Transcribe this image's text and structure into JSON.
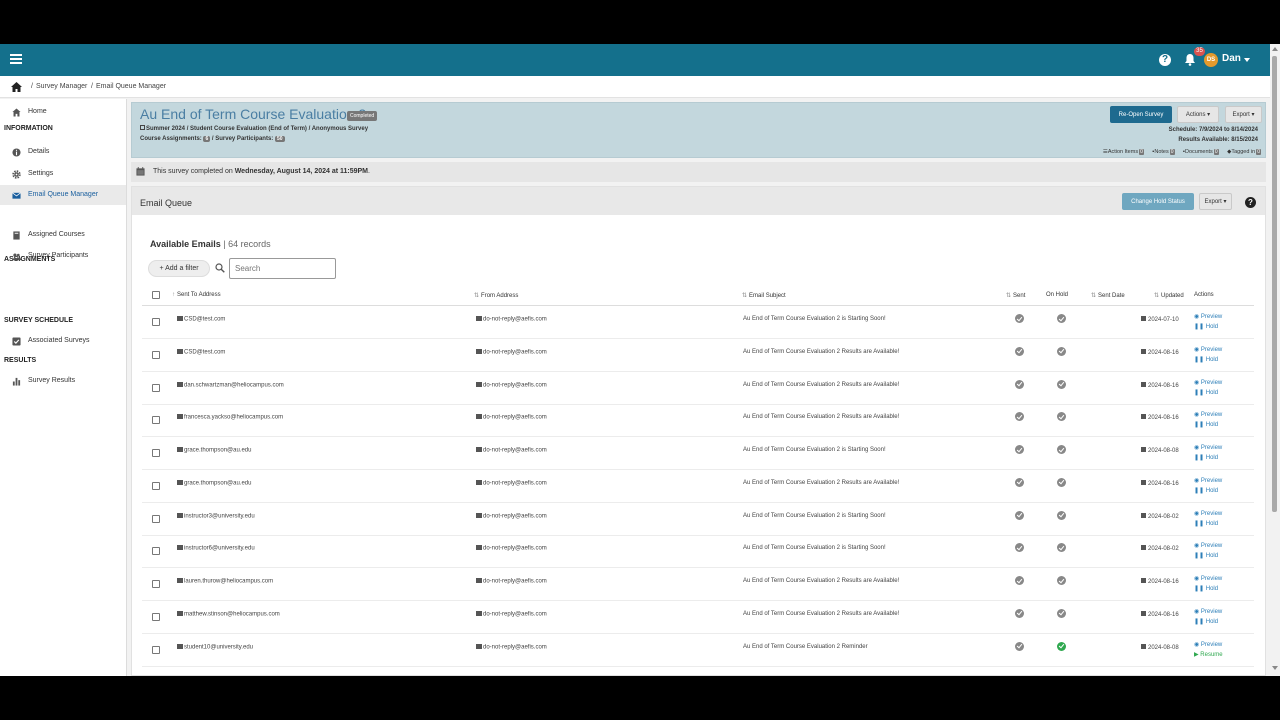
{
  "topbar": {
    "notification_count": "35",
    "avatar_initials": "DS",
    "user_name": "Dan"
  },
  "breadcrumb": [
    "Survey Manager",
    "Email Queue Manager"
  ],
  "sidebar": {
    "home": "Home",
    "sections": [
      {
        "heading": "INFORMATION",
        "items": [
          "Details",
          "Settings",
          "Email Queue Manager"
        ]
      },
      {
        "heading": "ASSIGNMENTS",
        "items": [
          "Assigned Courses",
          "Survey Participants"
        ]
      },
      {
        "heading": "SURVEY SCHEDULE",
        "items": [
          "Associated Surveys"
        ]
      },
      {
        "heading": "RESULTS",
        "items": [
          "Survey Results"
        ]
      }
    ]
  },
  "survey": {
    "title": "Au End of Term Course Evaluation 2",
    "status_badge": "Completed",
    "meta": "Summer 2024 / Student Course Evaluation  (End of Term)  / Anonymous Survey",
    "course_assignments_label": "Course Assignments:",
    "course_assignments": "6",
    "participants_label": "/ Survey Participants:",
    "participants": "50",
    "reopen_label": "Re-Open Survey",
    "actions_label": "Actions",
    "export_label": "Export",
    "schedule": "Schedule: 7/9/2024 to 8/14/2024",
    "results_available": "Results Available: 8/15/2024",
    "tags": [
      {
        "label": "Action Items",
        "count": "0"
      },
      {
        "label": "Notes",
        "count": "0"
      },
      {
        "label": "Documents",
        "count": "0"
      },
      {
        "label": "Tagged in",
        "count": "0"
      }
    ]
  },
  "notice": {
    "prefix": "This survey completed on ",
    "date": "Wednesday, August 14, 2024 at 11:59PM",
    "suffix": "."
  },
  "email_queue": {
    "title": "Email Queue",
    "hold_status_label": "Change Hold Status",
    "export_label": "Export",
    "available_label": "Available Emails",
    "records": "| 64 records",
    "add_filter_label": "Add a filter",
    "search_placeholder": "Search",
    "columns": [
      "Sent To Address",
      "From Address",
      "Email Subject",
      "Sent",
      "On Hold",
      "Sent Date",
      "Updated",
      "Actions"
    ],
    "rows": [
      {
        "to": "CSD@test.com",
        "from": "do-not-reply@aefis.com",
        "subject": "Au End of Term Course Evaluation 2 is Starting Soon!",
        "on_hold": false,
        "updated": "2024-07-10",
        "preview": "Preview",
        "second_action": "Hold"
      },
      {
        "to": "CSD@test.com",
        "from": "do-not-reply@aefis.com",
        "subject": "Au End of Term Course Evaluation 2 Results are Available!",
        "on_hold": false,
        "updated": "2024-08-16",
        "preview": "Preview",
        "second_action": "Hold"
      },
      {
        "to": "dan.schwartzman@heliocampus.com",
        "from": "do-not-reply@aefis.com",
        "subject": "Au End of Term Course Evaluation 2 Results are Available!",
        "on_hold": false,
        "updated": "2024-08-16",
        "preview": "Preview",
        "second_action": "Hold"
      },
      {
        "to": "francesca.yackso@heliocampus.com",
        "from": "do-not-reply@aefis.com",
        "subject": "Au End of Term Course Evaluation 2 Results are Available!",
        "on_hold": false,
        "updated": "2024-08-16",
        "preview": "Preview",
        "second_action": "Hold"
      },
      {
        "to": "grace.thompson@au.edu",
        "from": "do-not-reply@aefis.com",
        "subject": "Au End of Term Course Evaluation 2 is Starting Soon!",
        "on_hold": false,
        "updated": "2024-08-08",
        "preview": "Preview",
        "second_action": "Hold"
      },
      {
        "to": "grace.thompson@au.edu",
        "from": "do-not-reply@aefis.com",
        "subject": "Au End of Term Course Evaluation 2 Results are Available!",
        "on_hold": false,
        "updated": "2024-08-16",
        "preview": "Preview",
        "second_action": "Hold"
      },
      {
        "to": "instructor3@university.edu",
        "from": "do-not-reply@aefis.com",
        "subject": "Au End of Term Course Evaluation 2 is Starting Soon!",
        "on_hold": false,
        "updated": "2024-08-02",
        "preview": "Preview",
        "second_action": "Hold"
      },
      {
        "to": "instructor6@university.edu",
        "from": "do-not-reply@aefis.com",
        "subject": "Au End of Term Course Evaluation 2 is Starting Soon!",
        "on_hold": false,
        "updated": "2024-08-02",
        "preview": "Preview",
        "second_action": "Hold"
      },
      {
        "to": "lauren.thurow@heliocampus.com",
        "from": "do-not-reply@aefis.com",
        "subject": "Au End of Term Course Evaluation 2 Results are Available!",
        "on_hold": false,
        "updated": "2024-08-16",
        "preview": "Preview",
        "second_action": "Hold"
      },
      {
        "to": "matthew.stinson@heliocampus.com",
        "from": "do-not-reply@aefis.com",
        "subject": "Au End of Term Course Evaluation 2 Results are Available!",
        "on_hold": false,
        "updated": "2024-08-16",
        "preview": "Preview",
        "second_action": "Hold"
      },
      {
        "to": "student10@university.edu",
        "from": "do-not-reply@aefis.com",
        "subject": "Au End of Term Course Evaluation 2 Reminder",
        "on_hold": true,
        "updated": "2024-08-08",
        "preview": "Preview",
        "second_action": "Resume"
      }
    ]
  },
  "colors": {
    "topbar": "#14708c",
    "header_panel": "#c3d7dd",
    "link": "#2d7fb8",
    "hold_green": "#2fa84f"
  }
}
